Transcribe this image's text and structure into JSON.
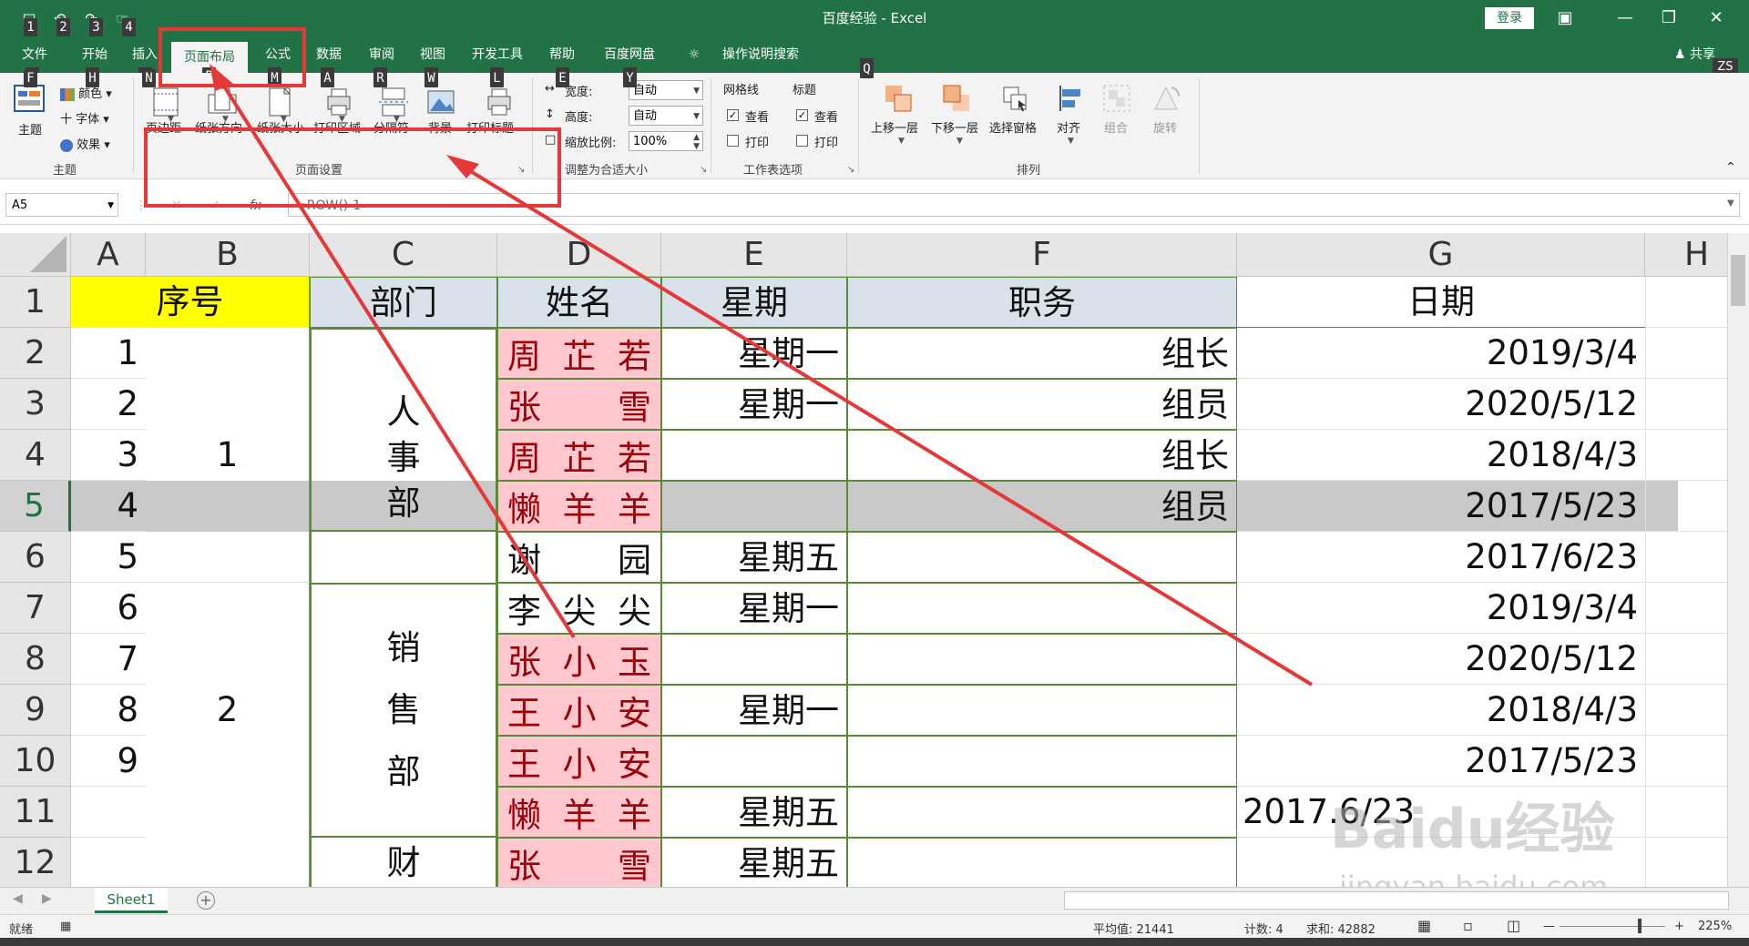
{
  "title_bar": {
    "title": "百度经验 - Excel",
    "login_label": "登录",
    "qat_keytips": [
      "1",
      "2",
      "3",
      "4"
    ]
  },
  "tabs": [
    {
      "label": "文件",
      "keytip": "F"
    },
    {
      "label": "开始",
      "keytip": "H"
    },
    {
      "label": "插入",
      "keytip": "N"
    },
    {
      "label": "页面布局",
      "keytip": "P"
    },
    {
      "label": "公式",
      "keytip": "M"
    },
    {
      "label": "数据",
      "keytip": "A"
    },
    {
      "label": "审阅",
      "keytip": "R"
    },
    {
      "label": "视图",
      "keytip": "W"
    },
    {
      "label": "开发工具",
      "keytip": "L"
    },
    {
      "label": "帮助",
      "keytip": "E"
    },
    {
      "label": "百度网盘",
      "keytip": "Y"
    },
    {
      "label": "操作说明搜索",
      "keytip": "Q"
    }
  ],
  "share_label": "共享",
  "avatar_initials": "ZS",
  "ribbon": {
    "theme_group": {
      "label": "主题",
      "theme_btn": "主题",
      "colors": "颜色",
      "fonts": "字体",
      "effects": "效果"
    },
    "page_setup": {
      "label": "页面设置",
      "buttons": [
        "页边距",
        "纸张方向",
        "纸张大小",
        "打印区域",
        "分隔符",
        "背景",
        "打印标题"
      ]
    },
    "scale_fit": {
      "label": "调整为合适大小",
      "width_label": "宽度:",
      "width_value": "自动",
      "height_label": "高度:",
      "height_value": "自动",
      "scale_label": "缩放比例:",
      "scale_value": "100%"
    },
    "sheet_options": {
      "label": "工作表选项",
      "gridlines": "网格线",
      "headings": "标题",
      "view": "查看",
      "print": "打印"
    },
    "arrange": {
      "label": "排列",
      "buttons": [
        "上移一层",
        "下移一层",
        "选择窗格",
        "对齐",
        "组合",
        "旋转"
      ]
    }
  },
  "formula_bar": {
    "name_box": "A5",
    "formula": "=ROW()-1"
  },
  "columns": [
    "A",
    "B",
    "C",
    "D",
    "E",
    "F",
    "G",
    "H"
  ],
  "rows": [
    "1",
    "2",
    "3",
    "4",
    "5",
    "6",
    "7",
    "8",
    "9",
    "10",
    "11",
    "12"
  ],
  "headers": {
    "A_B": "序号",
    "C": "部门",
    "D": "姓名",
    "E": "星期",
    "F": "职务",
    "G": "日期"
  },
  "col_a": [
    "1",
    "2",
    "3",
    "4",
    "5",
    "6",
    "7",
    "8",
    "9"
  ],
  "col_b": {
    "group1": "1",
    "group2": "2"
  },
  "col_c": {
    "dept1": [
      "人",
      "事",
      "部"
    ],
    "dept2": [
      "销",
      "售",
      "部"
    ],
    "dept3_partial": "财"
  },
  "col_d": [
    [
      "周",
      "芷",
      "若"
    ],
    [
      "张",
      "",
      "雪"
    ],
    [
      "周",
      "芷",
      "若"
    ],
    [
      "懒",
      "羊",
      "羊"
    ],
    [
      "谢",
      "",
      "园"
    ],
    [
      "李",
      "尖",
      "尖"
    ],
    [
      "张",
      "小",
      "玉"
    ],
    [
      "王",
      "小",
      "安"
    ],
    [
      "王",
      "小",
      "安"
    ],
    [
      "懒",
      "羊",
      "羊"
    ],
    [
      "张",
      "",
      "雪"
    ]
  ],
  "col_e": [
    "星期一",
    "星期一",
    "",
    "",
    "星期五",
    "星期一",
    "",
    "星期一",
    "",
    "星期五",
    "星期五"
  ],
  "col_f": [
    "组长",
    "组员",
    "组长",
    "组员",
    "",
    "",
    "",
    "",
    "",
    "",
    ""
  ],
  "col_g": [
    "2019/3/4",
    "2020/5/12",
    "2018/4/3",
    "2017/5/23",
    "2017/6/23",
    "2019/3/4",
    "2020/5/12",
    "2018/4/3",
    "2017/5/23",
    "2017.6/23",
    ""
  ],
  "sheet_tab": "Sheet1",
  "status": {
    "ready": "就绪",
    "average": "平均值: 21441",
    "count": "计数: 4",
    "sum": "求和: 42882",
    "zoom": "225%"
  },
  "watermark": {
    "brand": "Baidu经验",
    "url": "jingyan.baidu.com"
  },
  "colors": {
    "excel_green": "#217346",
    "header_yellow": "#ffff00",
    "header_blue": "#d9e1eb",
    "name_pink": "#ffc7ce",
    "name_red_text": "#9c0006",
    "selected_row": "#c9c9c9",
    "annotation_red": "#e63838"
  }
}
